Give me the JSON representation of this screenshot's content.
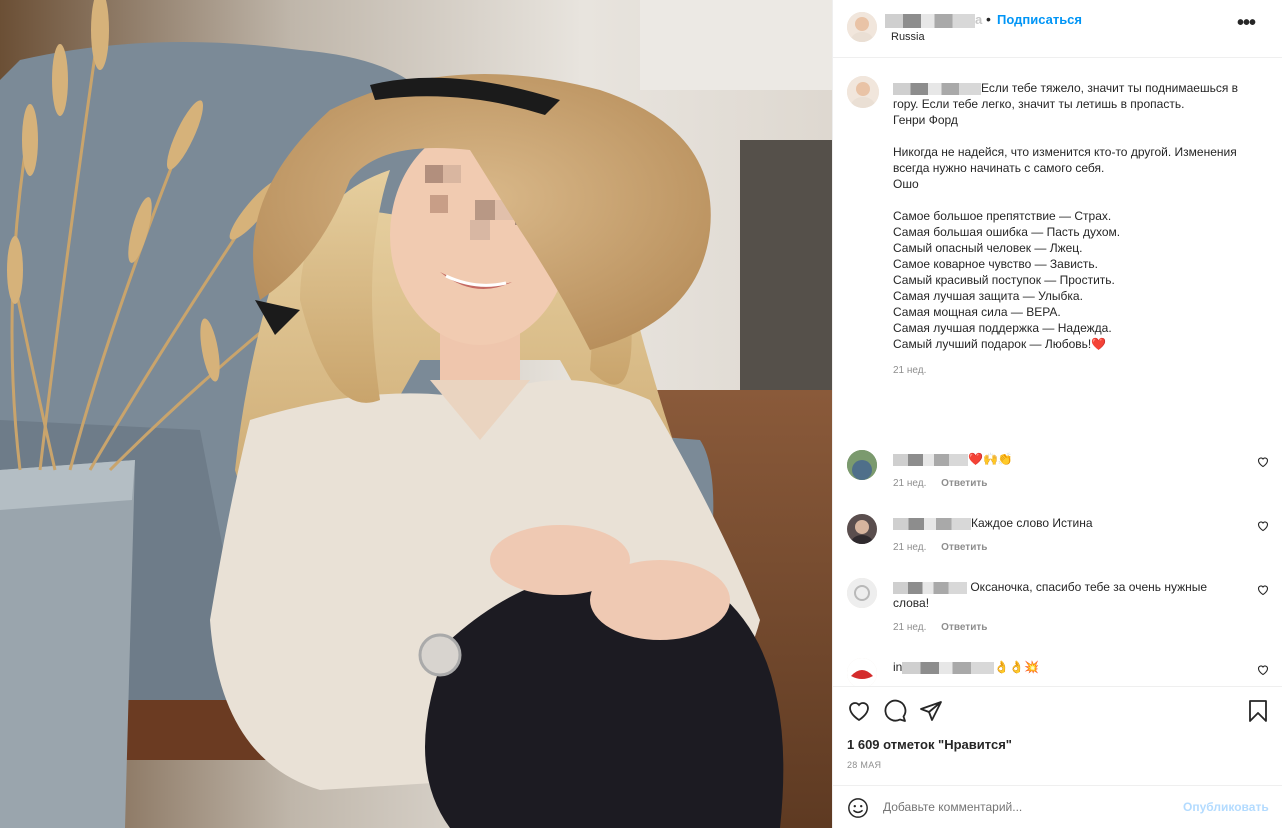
{
  "post": {
    "username_suffix": "a",
    "separator": "•",
    "follow_label": "Подписаться",
    "location": "Russia",
    "more_label": "•••"
  },
  "caption": {
    "lines_1": [
      "Если тебе тяжело, значит ты поднимаешься в гору. Если тебе легко, значит ты летишь в пропасть.",
      "Генри Форд"
    ],
    "lines_2": [
      "Никогда не надейся, что изменится кто-то другой. Изменения всегда нужно начинать с самого себя.",
      "Ошо"
    ],
    "lines_3": [
      "Самое большое препятствие — Страх.",
      "Самая большая ошибка — Пасть духом.",
      "Самый опасный человек — Лжец.",
      "Самое коварное чувство — Зависть.",
      "Самый красивый поступок — Простить.",
      "Самая лучшая защита — Улыбка.",
      "Самая мощная сила — ВЕРА.",
      "Самая лучшая поддержка — Надежда.",
      "Самый лучший подарок — Любовь!❤️"
    ],
    "time": "21 нед."
  },
  "comments": [
    {
      "text": "❤️🙌👏",
      "time": "21 нед.",
      "reply": "Ответить"
    },
    {
      "text": "Каждое слово Истина",
      "time": "21 нед.",
      "reply": "Ответить"
    },
    {
      "text": "Оксаночка, спасибо тебе за очень нужные слова!",
      "time": "21 нед.",
      "reply": "Ответить"
    },
    {
      "prefix": "in",
      "text": "👌👌💥"
    }
  ],
  "actions": {
    "likes": "1 609 отметок \"Нравится\"",
    "date": "28 МАЯ",
    "comment_placeholder": "Добавьте комментарий...",
    "publish_label": "Опубликовать"
  },
  "colors": {
    "accent": "#0095f6",
    "publish_disabled": "#b3dbff",
    "muted": "#8e8e8e",
    "heart": "#ed1c24"
  },
  "icons": [
    "heart-icon",
    "comment-icon",
    "share-icon",
    "bookmark-icon",
    "emoji-icon",
    "more-icon"
  ]
}
